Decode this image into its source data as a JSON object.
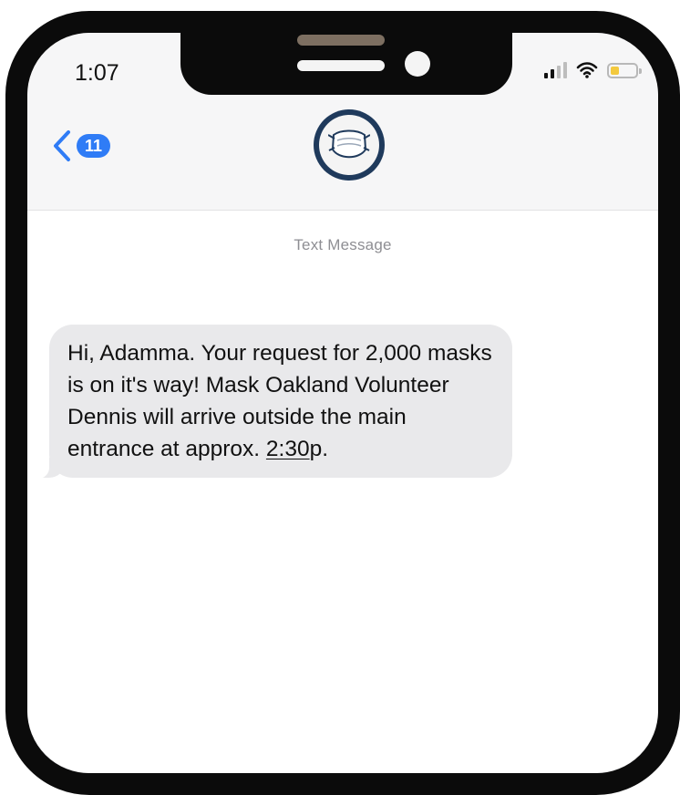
{
  "status_bar": {
    "time": "1:07",
    "battery_level": 0.35,
    "battery_color": "#f3c93e",
    "signal_bars": 2
  },
  "header": {
    "back_count": "11",
    "back_icon": "chevron-left-icon",
    "avatar_icon": "face-mask-icon",
    "accent_color": "#2f7cf6"
  },
  "conversation": {
    "meta_label": "Text Message",
    "messages": [
      {
        "direction": "incoming",
        "text_before_time": "Hi, Adamma. Your request for 2,000 masks is on it's way! Mask Oakland Volunteer Dennis will arrive outside the main entrance at approx. ",
        "time": "2:30",
        "text_after_time": "p."
      }
    ]
  }
}
